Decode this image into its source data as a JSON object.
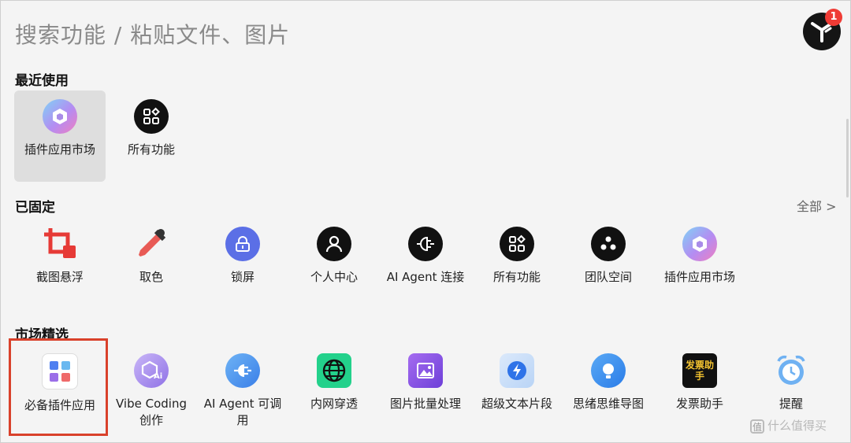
{
  "search": {
    "placeholder": "搜索功能 / 粘贴文件、图片"
  },
  "avatar": {
    "notification_count": "1"
  },
  "recent": {
    "title": "最近使用",
    "items": [
      {
        "label": "插件应用市场",
        "icon": "plugin-market-icon"
      },
      {
        "label": "所有功能",
        "icon": "all-features-icon"
      }
    ]
  },
  "pinned": {
    "title": "已固定",
    "all_link": "全部 >",
    "items": [
      {
        "label": "截图悬浮",
        "icon": "screenshot-pin-icon"
      },
      {
        "label": "取色",
        "icon": "color-picker-icon"
      },
      {
        "label": "锁屏",
        "icon": "lock-screen-icon"
      },
      {
        "label": "个人中心",
        "icon": "user-icon"
      },
      {
        "label": "AI Agent 连接",
        "icon": "plug-connect-icon"
      },
      {
        "label": "所有功能",
        "icon": "all-features-icon"
      },
      {
        "label": "团队空间",
        "icon": "team-icon"
      },
      {
        "label": "插件应用市场",
        "icon": "plugin-market-icon"
      }
    ]
  },
  "market": {
    "title": "市场精选",
    "items": [
      {
        "label": "必备插件应用",
        "icon": "essential-plugins-icon"
      },
      {
        "label": "Vibe Coding 创作",
        "icon": "vibe-coding-icon"
      },
      {
        "label": "AI Agent 可调用",
        "icon": "ai-agent-plug-icon"
      },
      {
        "label": "内网穿透",
        "icon": "globe-icon"
      },
      {
        "label": "图片批量处理",
        "icon": "image-batch-icon"
      },
      {
        "label": "超级文本片段",
        "icon": "text-snippet-icon"
      },
      {
        "label": "思绪思维导图",
        "icon": "mind-map-icon"
      },
      {
        "label": "发票助手",
        "icon": "invoice-icon",
        "icon_text": "发票助手"
      },
      {
        "label": "提醒",
        "icon": "alarm-clock-icon"
      }
    ]
  },
  "watermark": {
    "badge": "值",
    "text": "什么值得买"
  },
  "colors": {
    "accent_red": "#ef3b35",
    "highlight_box": "#d9412b",
    "selected_bg": "#dedede"
  }
}
